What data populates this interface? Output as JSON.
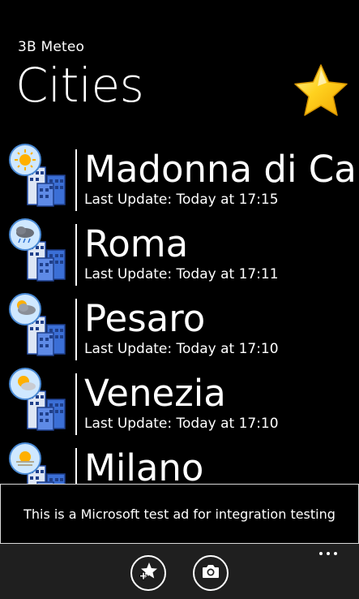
{
  "header": {
    "app_name": "3B Meteo",
    "page_title": "Cities"
  },
  "cities": [
    {
      "name": "Madonna di Car",
      "update": "Last Update: Today at 17:15",
      "weather": "sunny"
    },
    {
      "name": "Roma",
      "update": "Last Update: Today at 17:11",
      "weather": "rain"
    },
    {
      "name": "Pesaro",
      "update": "Last Update: Today at 17:10",
      "weather": "partly-cloudy"
    },
    {
      "name": "Venezia",
      "update": "Last Update: Today at 17:10",
      "weather": "sun-cloud"
    },
    {
      "name": "Milano",
      "update": "",
      "weather": "sunny-haze"
    }
  ],
  "ad": {
    "text": "This is a Microsoft test ad for integration testing"
  },
  "appbar": {
    "buttons": [
      "add-favorite",
      "camera"
    ],
    "more": "more-options"
  },
  "colors": {
    "background": "#000000",
    "appbar": "#1f1f1f",
    "star": "#ffd21f",
    "building": "#3b6fd6"
  }
}
